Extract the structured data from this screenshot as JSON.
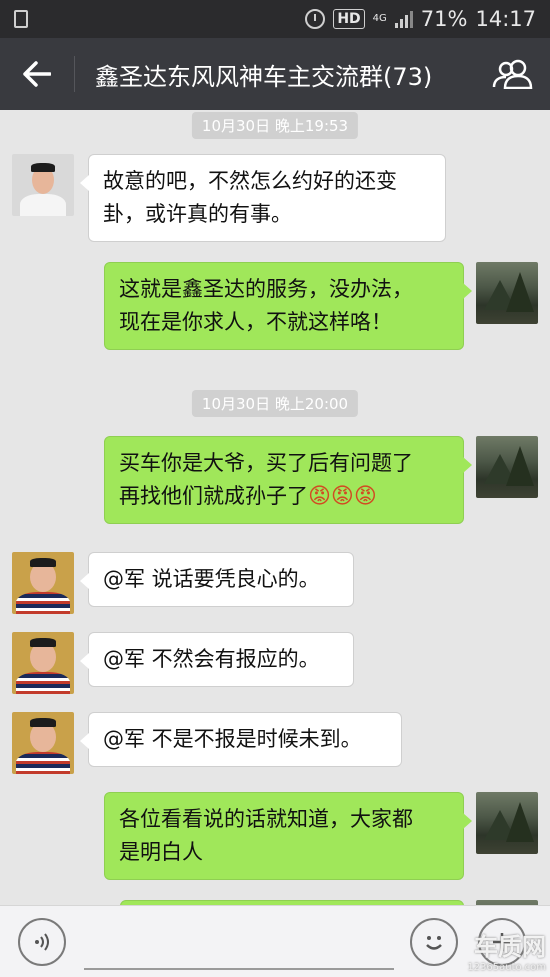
{
  "status_bar": {
    "hd_label": "HD",
    "network_label": "4G",
    "battery": "71%",
    "time": "14:17"
  },
  "header": {
    "back_icon": "back-arrow-icon",
    "title": "鑫圣达东风风神车主交流群(73)",
    "members_icon": "group-members-icon"
  },
  "timestamps": [
    "10月30日 晚上19:53",
    "10月30日 晚上20:00"
  ],
  "messages": [
    {
      "side": "left",
      "avatar": "avatar-man-glasses",
      "text_lines": [
        "故意的吧，不然怎么约好的还变",
        "卦，或许真的有事。"
      ]
    },
    {
      "side": "right",
      "avatar": "avatar-landscape",
      "text_lines": [
        "这就是鑫圣达的服务，没办法，",
        "现在是你求人，不就这样咯！"
      ]
    },
    {
      "side": "right",
      "avatar": "avatar-landscape",
      "text_lines": [
        "买车你是大爷，买了后有问题了",
        "再找他们就成孙子了"
      ],
      "emoji": "😡😡😡"
    },
    {
      "side": "left",
      "avatar": "avatar-man-stripes",
      "text_lines": [
        "@军 说话要凭良心的。"
      ]
    },
    {
      "side": "left",
      "avatar": "avatar-man-stripes",
      "text_lines": [
        "@军 不然会有报应的。"
      ]
    },
    {
      "side": "left",
      "avatar": "avatar-man-stripes",
      "text_lines": [
        "@军 不是不报是时候未到。"
      ]
    },
    {
      "side": "right",
      "avatar": "avatar-landscape",
      "text_lines": [
        "各位看看说的话就知道，大家都",
        "是明白人"
      ]
    }
  ],
  "input_bar": {
    "voice_icon": "voice-icon",
    "emoji_icon": "emoji-icon",
    "plus_icon": "plus-icon"
  },
  "watermark": {
    "logo": "车质网",
    "url": "12365auto.com"
  }
}
